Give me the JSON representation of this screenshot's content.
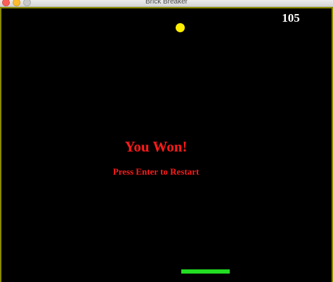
{
  "window": {
    "title": "Brick Breaker"
  },
  "game": {
    "score": "105",
    "message": "You Won!",
    "prompt": "Press Enter to Restart"
  },
  "colors": {
    "background": "#000000",
    "border": "#8a8a00",
    "score_text": "#ffffff",
    "ball": "#ffee00",
    "message_text": "#ff1a1a",
    "paddle": "#22dd22",
    "close_button": "#fc5f57",
    "minimize_button": "#fdbc2e",
    "zoom_button": "#c9c9c9"
  },
  "icons": {
    "close": "close-icon",
    "minimize": "minimize-icon",
    "zoom": "zoom-icon"
  }
}
